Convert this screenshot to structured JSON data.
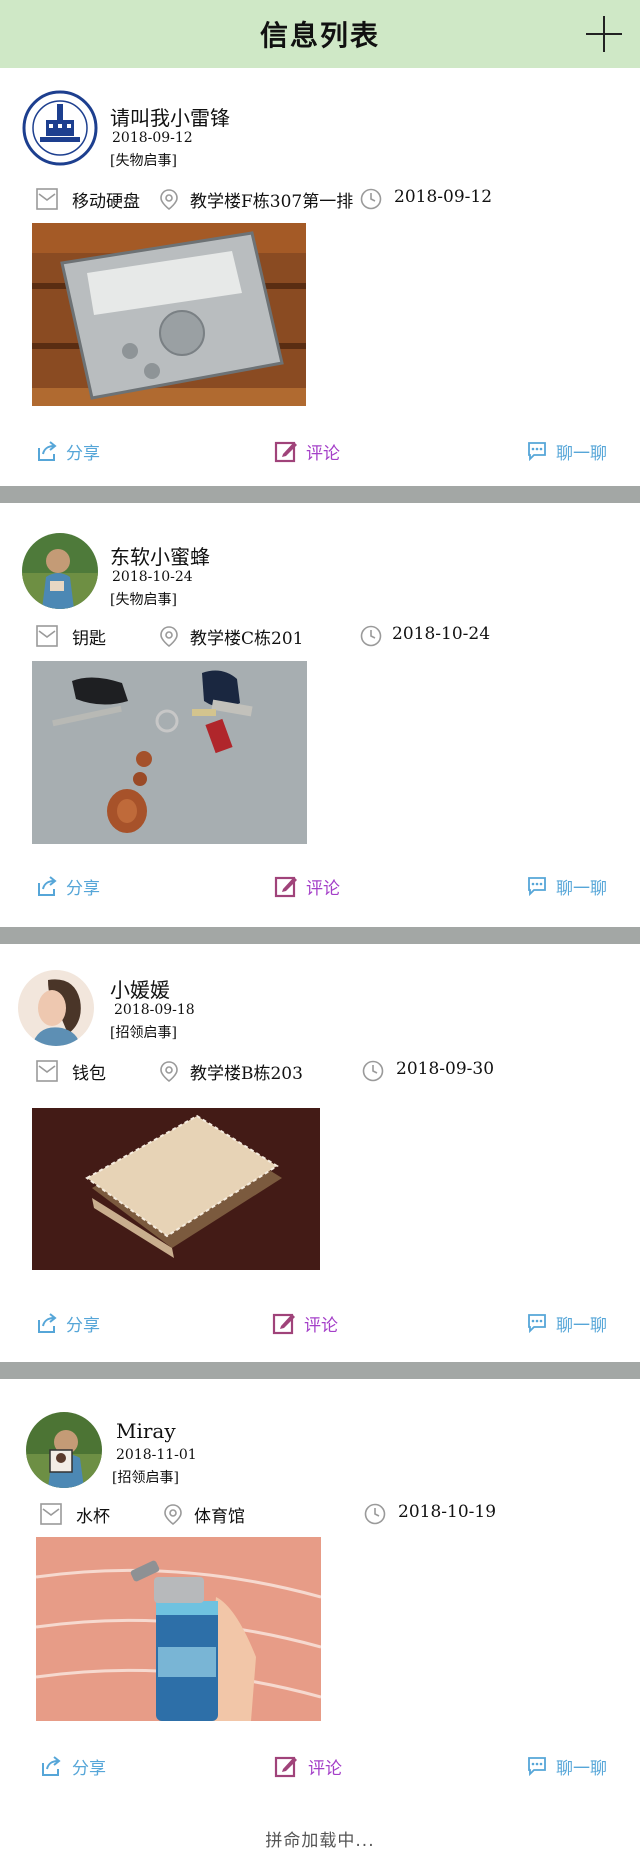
{
  "header": {
    "title": "信息列表"
  },
  "posts": [
    {
      "username": "请叫我小雷锋",
      "date": "2018-09-12",
      "type": "[失物启事]",
      "item": "移动硬盘",
      "location": "教学楼F栋307第一排",
      "event_date": "2018-09-12"
    },
    {
      "username": "东软小蜜蜂",
      "date": "2018-10-24",
      "type": "[失物启事]",
      "item": "钥匙",
      "location": "教学楼C栋201",
      "event_date": "2018-10-24"
    },
    {
      "username": "小媛媛",
      "date": "2018-09-18",
      "type": "[招领启事]",
      "item": "钱包",
      "location": "教学楼B栋203",
      "event_date": "2018-09-30"
    },
    {
      "username": "Miray",
      "date": "2018-11-01",
      "type": "[招领启事]",
      "item": "水杯",
      "location": "体育馆",
      "event_date": "2018-10-19"
    }
  ],
  "actions": {
    "share": "分享",
    "comment": "评论",
    "chat": "聊一聊"
  },
  "footer": {
    "loading": "拼命加载中..."
  },
  "colors": {
    "header_bg": "#cfe8c6",
    "share": "#56a6d8",
    "comment": "#a43fc8",
    "divider": "#a3a7a5"
  }
}
